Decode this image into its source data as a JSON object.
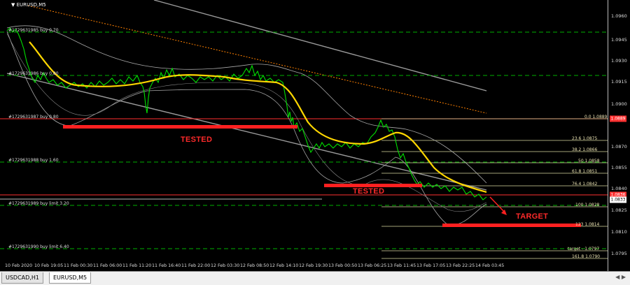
{
  "window": {
    "title": "EURUSD,M5"
  },
  "tabs": [
    {
      "label": "USDCAD,H1",
      "active": false
    },
    {
      "label": "EURUSD,M5",
      "active": true
    }
  ],
  "tab_scroll_icon": "left-right-arrows-icon",
  "price_axis": {
    "labels": [
      "1.0960",
      "1.0945",
      "1.0930",
      "1.0915",
      "1.0900",
      "1.0870",
      "1.0855",
      "1.0840",
      "1.0825",
      "1.0810",
      "1.0795"
    ],
    "tags": [
      {
        "text": "1.0889",
        "color": "#ff3030",
        "text_color": "#ffffff"
      },
      {
        "text": "1.0836",
        "color": "#ff3030",
        "text_color": "#ffffff"
      },
      {
        "text": "1.0833",
        "color": "#ffffff",
        "text_color": "#000000"
      }
    ]
  },
  "time_axis": {
    "labels": [
      "10 Feb 2020",
      "10 Feb 19:05",
      "11 Feb 00:30",
      "11 Feb 06:00",
      "11 Feb 11:20",
      "11 Feb 16:40",
      "11 Feb 22:00",
      "12 Feb 03:30",
      "12 Feb 08:50",
      "12 Feb 14:10",
      "12 Feb 19:30",
      "13 Feb 00:50",
      "13 Feb 06:25",
      "13 Feb 11:45",
      "13 Feb 17:05",
      "13 Feb 22:25",
      "14 Feb 03:45"
    ]
  },
  "orders": [
    "#1729631985 buy 0.70",
    "#1729631986 buy 0.80",
    "#1729631987 buy 0.80",
    "#1729631988 buy 1.60",
    "#1729631989 buy limit 3.20",
    "#1729631990 buy limit 6.40"
  ],
  "fib_levels": [
    "0.0  1.0889",
    "23.6  1.0875",
    "38.2  1.0866",
    "50  1.0858",
    "61.8  1.0851",
    "76.4  1.0842",
    "100  1.0828",
    "123  1.0814",
    "target - 1.0797",
    "161.8  1.0790"
  ],
  "annotations": {
    "tested_1": "TESTED",
    "tested_2": "TESTED",
    "target": "TARGET"
  },
  "colors": {
    "background": "#000000",
    "price_line": "#00e000",
    "moving_average": "#ffd700",
    "order_line": "#00c000",
    "fib_line": "#d8d8a0",
    "annotation": "#ff2020",
    "envelope": "#a0a0a0",
    "channel": "#909090",
    "channel_dotted": "#ff8000"
  }
}
